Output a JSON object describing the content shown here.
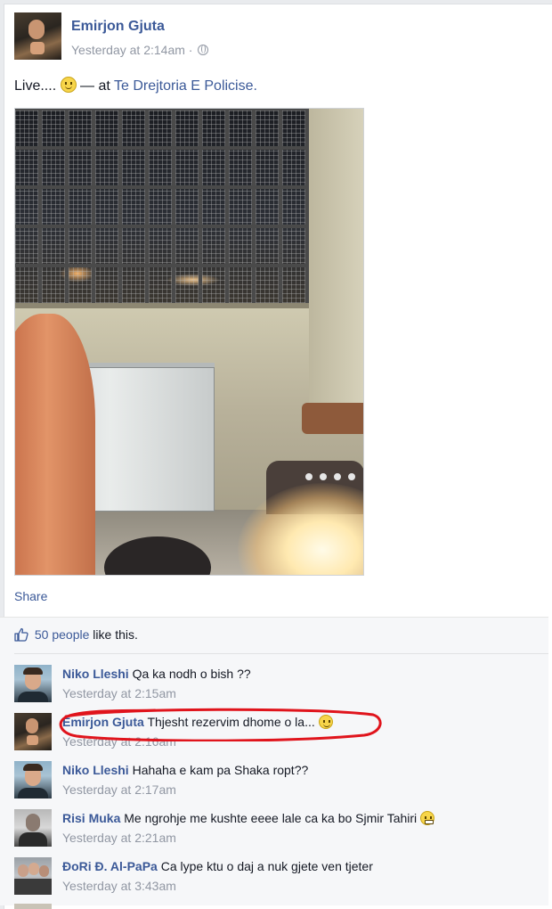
{
  "post": {
    "author": "Emirjon Gjuta",
    "timestamp": "Yesterday at 2:14am",
    "separator": "·",
    "privacy_icon": "globe-icon",
    "status_text": "Live....",
    "status_emoticon": "smiley-icon",
    "status_at": "— at",
    "place": "Te Drejtoria E Policise.",
    "share_label": "Share"
  },
  "likes": {
    "icon": "thumbs-up-icon",
    "count_text": "50 people",
    "suffix": "like this."
  },
  "comments": [
    {
      "author": "Niko Lleshi",
      "text": "Qa ka nodh o bish ??",
      "time": "Yesterday at 2:15am"
    },
    {
      "author": "Emirjon Gjuta",
      "text": "Thjesht rezervim dhome o la...",
      "time": "Yesterday at 2:16am",
      "emoticon": "smiley-icon",
      "highlighted": true
    },
    {
      "author": "Niko Lleshi",
      "text": "Hahaha e kam pa Shaka ropt??",
      "time": "Yesterday at 2:17am"
    },
    {
      "author": "Risi Muka",
      "text": "Me ngrohje me kushte eeee lale ca ka bo Sjmir Tahiri",
      "time": "Yesterday at 2:21am",
      "emoticon": "grimace-icon"
    },
    {
      "author": "ĐoRi Đ. Al-PaPa",
      "text": "Ca lype ktu o daj a nuk gjete ven tjeter",
      "time": "Yesterday at 3:43am"
    }
  ],
  "colors": {
    "link_blue": "#3b5998",
    "meta_gray": "#9197a3",
    "highlight_red": "#e0141c"
  }
}
